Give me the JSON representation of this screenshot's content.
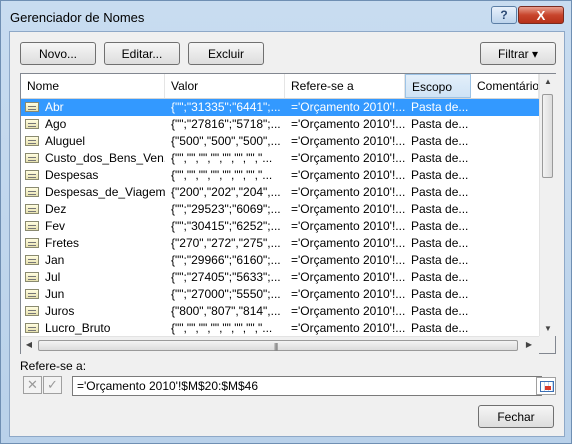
{
  "window": {
    "title": "Gerenciador de Nomes",
    "help_icon": "?",
    "close_icon": "X"
  },
  "toolbar": {
    "new_label": "Novo...",
    "edit_label": "Editar...",
    "delete_label": "Excluir",
    "filter_label": "Filtrar",
    "filter_arrow": "▾"
  },
  "list": {
    "headers": {
      "name": "Nome",
      "value": "Valor",
      "refers_to": "Refere-se a",
      "scope": "Escopo",
      "comment": "Comentário"
    },
    "selected_index": 0,
    "rows": [
      {
        "name": "Abr",
        "value": "{\"\";\"31335\";\"6441\";...",
        "refers_to": "='Orçamento 2010'!...",
        "scope": "Pasta de..."
      },
      {
        "name": "Ago",
        "value": "{\"\";\"27816\";\"5718\";...",
        "refers_to": "='Orçamento 2010'!...",
        "scope": "Pasta de..."
      },
      {
        "name": "Aluguel",
        "value": "{\"500\",\"500\",\"500\",...",
        "refers_to": "='Orçamento 2010'!...",
        "scope": "Pasta de..."
      },
      {
        "name": "Custo_dos_Bens_Ven...",
        "value": "{\"\",\"\",\"\",\"\",\"\",\"\",\"\",\"...",
        "refers_to": "='Orçamento 2010'!...",
        "scope": "Pasta de..."
      },
      {
        "name": "Despesas",
        "value": "{\"\",\"\",\"\",\"\",\"\",\"\",\"\",\"...",
        "refers_to": "='Orçamento 2010'!...",
        "scope": "Pasta de..."
      },
      {
        "name": "Despesas_de_Viagem",
        "value": "{\"200\",\"202\",\"204\",...",
        "refers_to": "='Orçamento 2010'!...",
        "scope": "Pasta de..."
      },
      {
        "name": "Dez",
        "value": "{\"\";\"29523\";\"6069\";...",
        "refers_to": "='Orçamento 2010'!...",
        "scope": "Pasta de..."
      },
      {
        "name": "Fev",
        "value": "{\"\";\"30415\";\"6252\";...",
        "refers_to": "='Orçamento 2010'!...",
        "scope": "Pasta de..."
      },
      {
        "name": "Fretes",
        "value": "{\"270\",\"272\",\"275\",...",
        "refers_to": "='Orçamento 2010'!...",
        "scope": "Pasta de..."
      },
      {
        "name": "Jan",
        "value": "{\"\";\"29966\";\"6160\";...",
        "refers_to": "='Orçamento 2010'!...",
        "scope": "Pasta de..."
      },
      {
        "name": "Jul",
        "value": "{\"\";\"27405\";\"5633\";...",
        "refers_to": "='Orçamento 2010'!...",
        "scope": "Pasta de..."
      },
      {
        "name": "Jun",
        "value": "{\"\";\"27000\";\"5550\";...",
        "refers_to": "='Orçamento 2010'!...",
        "scope": "Pasta de..."
      },
      {
        "name": "Juros",
        "value": "{\"800\",\"807\",\"814\",...",
        "refers_to": "='Orçamento 2010'!...",
        "scope": "Pasta de..."
      },
      {
        "name": "Lucro_Bruto",
        "value": "{\"\",\"\",\"\",\"\",\"\",\"\",\"\",\"...",
        "refers_to": "='Orçamento 2010'!...",
        "scope": "Pasta de..."
      }
    ]
  },
  "refers_to_panel": {
    "label": "Refere-se a:",
    "value": "='Orçamento 2010'!$M$20:$M$46"
  },
  "footer": {
    "close_label": "Fechar"
  },
  "colors": {
    "selection": "#3399ff",
    "frame": "#b9d1ea",
    "close_button": "#c8452d"
  }
}
